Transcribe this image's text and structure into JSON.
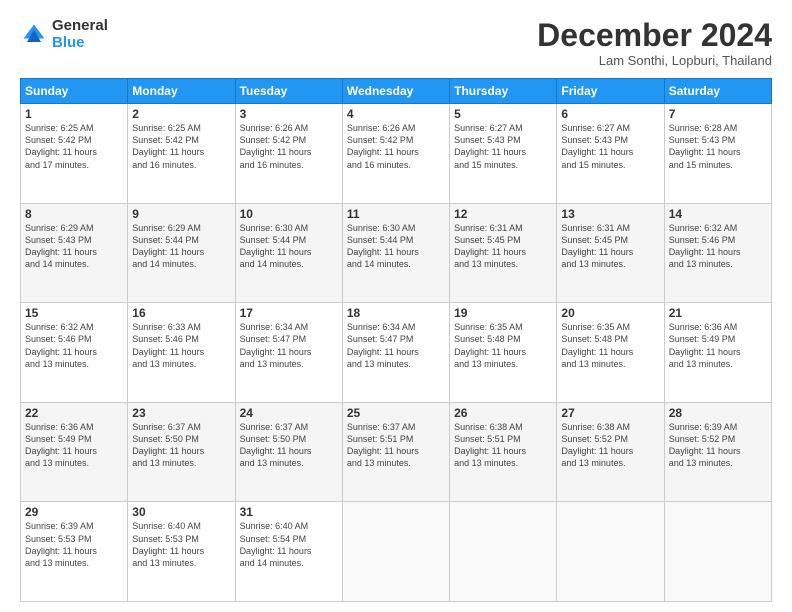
{
  "logo": {
    "general": "General",
    "blue": "Blue"
  },
  "header": {
    "month": "December 2024",
    "location": "Lam Sonthi, Lopburi, Thailand"
  },
  "weekdays": [
    "Sunday",
    "Monday",
    "Tuesday",
    "Wednesday",
    "Thursday",
    "Friday",
    "Saturday"
  ],
  "weeks": [
    [
      {
        "day": "1",
        "info": "Sunrise: 6:25 AM\nSunset: 5:42 PM\nDaylight: 11 hours\nand 17 minutes."
      },
      {
        "day": "2",
        "info": "Sunrise: 6:25 AM\nSunset: 5:42 PM\nDaylight: 11 hours\nand 16 minutes."
      },
      {
        "day": "3",
        "info": "Sunrise: 6:26 AM\nSunset: 5:42 PM\nDaylight: 11 hours\nand 16 minutes."
      },
      {
        "day": "4",
        "info": "Sunrise: 6:26 AM\nSunset: 5:42 PM\nDaylight: 11 hours\nand 16 minutes."
      },
      {
        "day": "5",
        "info": "Sunrise: 6:27 AM\nSunset: 5:43 PM\nDaylight: 11 hours\nand 15 minutes."
      },
      {
        "day": "6",
        "info": "Sunrise: 6:27 AM\nSunset: 5:43 PM\nDaylight: 11 hours\nand 15 minutes."
      },
      {
        "day": "7",
        "info": "Sunrise: 6:28 AM\nSunset: 5:43 PM\nDaylight: 11 hours\nand 15 minutes."
      }
    ],
    [
      {
        "day": "8",
        "info": "Sunrise: 6:29 AM\nSunset: 5:43 PM\nDaylight: 11 hours\nand 14 minutes."
      },
      {
        "day": "9",
        "info": "Sunrise: 6:29 AM\nSunset: 5:44 PM\nDaylight: 11 hours\nand 14 minutes."
      },
      {
        "day": "10",
        "info": "Sunrise: 6:30 AM\nSunset: 5:44 PM\nDaylight: 11 hours\nand 14 minutes."
      },
      {
        "day": "11",
        "info": "Sunrise: 6:30 AM\nSunset: 5:44 PM\nDaylight: 11 hours\nand 14 minutes."
      },
      {
        "day": "12",
        "info": "Sunrise: 6:31 AM\nSunset: 5:45 PM\nDaylight: 11 hours\nand 13 minutes."
      },
      {
        "day": "13",
        "info": "Sunrise: 6:31 AM\nSunset: 5:45 PM\nDaylight: 11 hours\nand 13 minutes."
      },
      {
        "day": "14",
        "info": "Sunrise: 6:32 AM\nSunset: 5:46 PM\nDaylight: 11 hours\nand 13 minutes."
      }
    ],
    [
      {
        "day": "15",
        "info": "Sunrise: 6:32 AM\nSunset: 5:46 PM\nDaylight: 11 hours\nand 13 minutes."
      },
      {
        "day": "16",
        "info": "Sunrise: 6:33 AM\nSunset: 5:46 PM\nDaylight: 11 hours\nand 13 minutes."
      },
      {
        "day": "17",
        "info": "Sunrise: 6:34 AM\nSunset: 5:47 PM\nDaylight: 11 hours\nand 13 minutes."
      },
      {
        "day": "18",
        "info": "Sunrise: 6:34 AM\nSunset: 5:47 PM\nDaylight: 11 hours\nand 13 minutes."
      },
      {
        "day": "19",
        "info": "Sunrise: 6:35 AM\nSunset: 5:48 PM\nDaylight: 11 hours\nand 13 minutes."
      },
      {
        "day": "20",
        "info": "Sunrise: 6:35 AM\nSunset: 5:48 PM\nDaylight: 11 hours\nand 13 minutes."
      },
      {
        "day": "21",
        "info": "Sunrise: 6:36 AM\nSunset: 5:49 PM\nDaylight: 11 hours\nand 13 minutes."
      }
    ],
    [
      {
        "day": "22",
        "info": "Sunrise: 6:36 AM\nSunset: 5:49 PM\nDaylight: 11 hours\nand 13 minutes."
      },
      {
        "day": "23",
        "info": "Sunrise: 6:37 AM\nSunset: 5:50 PM\nDaylight: 11 hours\nand 13 minutes."
      },
      {
        "day": "24",
        "info": "Sunrise: 6:37 AM\nSunset: 5:50 PM\nDaylight: 11 hours\nand 13 minutes."
      },
      {
        "day": "25",
        "info": "Sunrise: 6:37 AM\nSunset: 5:51 PM\nDaylight: 11 hours\nand 13 minutes."
      },
      {
        "day": "26",
        "info": "Sunrise: 6:38 AM\nSunset: 5:51 PM\nDaylight: 11 hours\nand 13 minutes."
      },
      {
        "day": "27",
        "info": "Sunrise: 6:38 AM\nSunset: 5:52 PM\nDaylight: 11 hours\nand 13 minutes."
      },
      {
        "day": "28",
        "info": "Sunrise: 6:39 AM\nSunset: 5:52 PM\nDaylight: 11 hours\nand 13 minutes."
      }
    ],
    [
      {
        "day": "29",
        "info": "Sunrise: 6:39 AM\nSunset: 5:53 PM\nDaylight: 11 hours\nand 13 minutes."
      },
      {
        "day": "30",
        "info": "Sunrise: 6:40 AM\nSunset: 5:53 PM\nDaylight: 11 hours\nand 13 minutes."
      },
      {
        "day": "31",
        "info": "Sunrise: 6:40 AM\nSunset: 5:54 PM\nDaylight: 11 hours\nand 14 minutes."
      },
      {
        "day": "",
        "info": ""
      },
      {
        "day": "",
        "info": ""
      },
      {
        "day": "",
        "info": ""
      },
      {
        "day": "",
        "info": ""
      }
    ]
  ]
}
